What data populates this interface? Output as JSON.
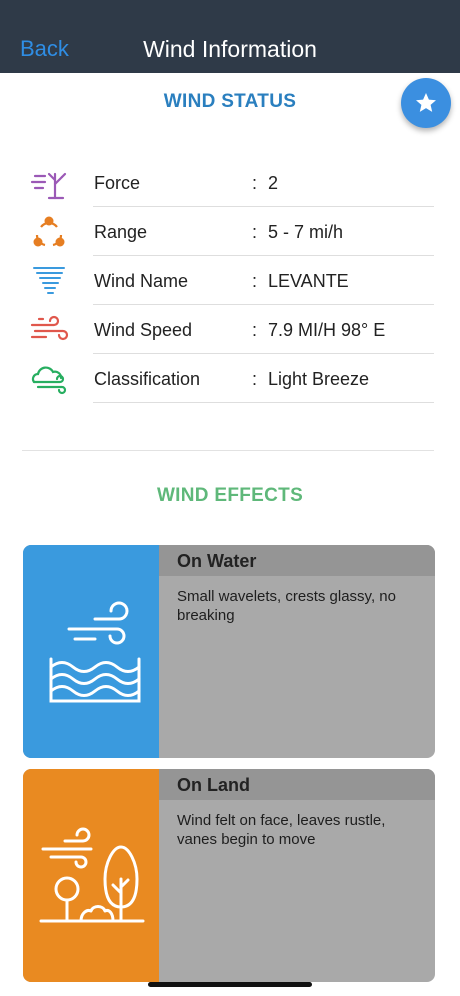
{
  "nav": {
    "back_label": "Back",
    "title": "Wind Information"
  },
  "status": {
    "title": "WIND STATUS",
    "rows": [
      {
        "icon": "tree-wind-icon",
        "label": "Force",
        "value": "2"
      },
      {
        "icon": "range-cycle-icon",
        "label": "Range",
        "value": "5 - 7  mi/h"
      },
      {
        "icon": "tornado-icon",
        "label": "Wind Name",
        "value": "LEVANTE"
      },
      {
        "icon": "wind-speed-icon",
        "label": "Wind Speed",
        "value": "7.9 MI/H 98° E"
      },
      {
        "icon": "cloud-wind-icon",
        "label": "Classification",
        "value": "Light Breeze"
      }
    ],
    "separator": ":"
  },
  "effects": {
    "title": "WIND EFFECTS",
    "water": {
      "heading": "On Water",
      "text": "Small wavelets, crests glassy, no breaking",
      "icon": "wind-waves-icon"
    },
    "land": {
      "heading": "On Land",
      "text": "Wind felt on face, leaves rustle, vanes begin to move",
      "icon": "wind-trees-icon"
    }
  },
  "colors": {
    "navbar": "#2f3a48",
    "accent_blue": "#2f8de4",
    "status_title": "#2a7fbf",
    "effects_title": "#5fb87a",
    "water_card": "#3a9ade",
    "land_card": "#e98a21",
    "card_body": "#a9a9a9"
  },
  "favorite_icon": "star-icon"
}
